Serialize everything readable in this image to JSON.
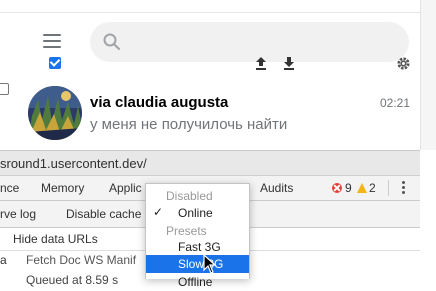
{
  "chat": {
    "name": "via claudia augusta",
    "time": "02:21",
    "preview": "у меня не получилочь найти"
  },
  "devtools": {
    "url_fragment": "sround1.usercontent.dev/",
    "tabs": [
      "nce",
      "Memory",
      "Applic",
      "Audits"
    ],
    "errors": "9",
    "warnings": "2",
    "toolbar": {
      "preserve_log": "rve log",
      "disable_cache": "Disable cache"
    },
    "filter": {
      "hide_data_urls": "Hide data URLs",
      "left_fragment": "a",
      "types_fragment": "Fetch  Doc  WS  Manif"
    },
    "row_text": "Queued at 8.59 s"
  },
  "throttling_menu": {
    "disabled_header": "Disabled",
    "online": "Online",
    "presets_header": "Presets",
    "fast3g": "Fast 3G",
    "slow3g": "Slow 3G",
    "offline": "Offline",
    "check": "✓"
  },
  "colors": {
    "accent": "#1a73e8",
    "error": "#e0423a",
    "warning": "#f2b518"
  }
}
